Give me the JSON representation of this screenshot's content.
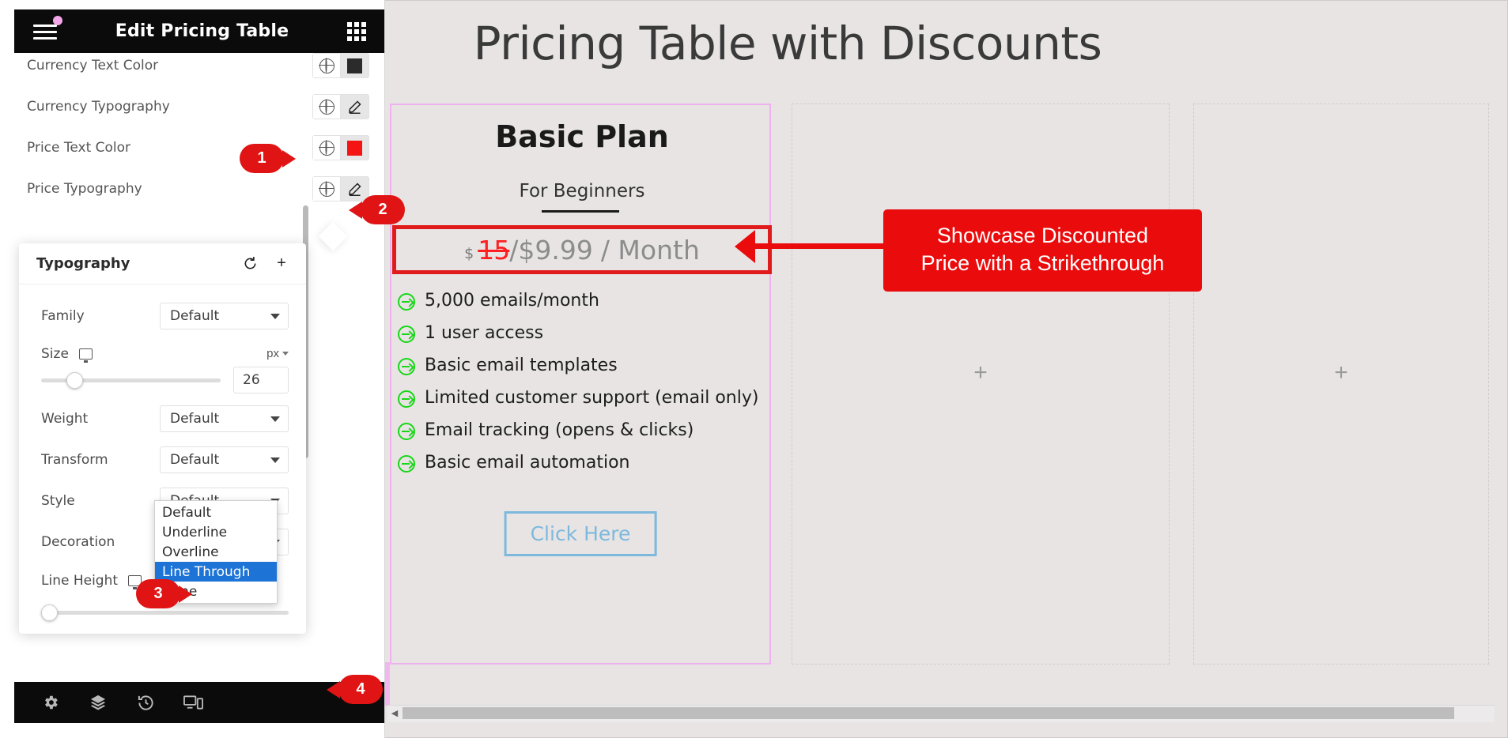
{
  "editor": {
    "header": {
      "title": "Edit Pricing Table",
      "menu_icon": "hamburger-icon",
      "apps_icon": "grid-apps-icon",
      "notification_dot": "#f3a6e8"
    },
    "settings": [
      {
        "label": "Currency Text Color",
        "globe_icon": "globe-icon",
        "second_icon": "color-swatch",
        "swatch_color": "#2b2b2b"
      },
      {
        "label": "Currency Typography",
        "globe_icon": "globe-icon",
        "second_icon": "pencil-edit-icon"
      },
      {
        "label": "Price Text Color",
        "globe_icon": "globe-icon",
        "second_icon": "color-swatch",
        "swatch_color": "#f51414"
      },
      {
        "label": "Price Typography",
        "globe_icon": "globe-icon",
        "second_icon": "pencil-edit-icon"
      }
    ],
    "typography_popover": {
      "title": "Typography",
      "reset_icon": "reset-arrow-icon",
      "add_icon": "plus-icon",
      "fields": {
        "family_label": "Family",
        "family_value": "Default",
        "size_label": "Size",
        "size_unit": "px",
        "size_value": "26",
        "weight_label": "Weight",
        "weight_value": "Default",
        "transform_label": "Transform",
        "transform_value": "Default",
        "style_label": "Style",
        "style_value": "Default",
        "decoration_label": "Decoration",
        "decoration_value": "Line Through",
        "line_height_label": "Line Height"
      },
      "decoration_options": [
        {
          "label": "Default",
          "selected": false
        },
        {
          "label": "Underline",
          "selected": false
        },
        {
          "label": "Overline",
          "selected": false
        },
        {
          "label": "Line Through",
          "selected": true
        },
        {
          "label": "None",
          "selected": false
        }
      ]
    },
    "bottom_toolbar": [
      {
        "icon": "settings-gear-icon",
        "name": "settings"
      },
      {
        "icon": "layers-navigator-icon",
        "name": "navigator"
      },
      {
        "icon": "history-clock-icon",
        "name": "history"
      },
      {
        "icon": "responsive-devices-icon",
        "name": "responsive-mode"
      }
    ],
    "collapse_icon": "chevron-left-icon"
  },
  "preview": {
    "page_title": "Pricing Table with Discounts",
    "card": {
      "plan_name": "Basic Plan",
      "subtitle": "For Beginners",
      "price": {
        "currency": "$",
        "old_price": "15",
        "separator": "/",
        "new_price": "$9.99",
        "period": "/ Month"
      },
      "features": [
        "5,000 emails/month",
        "1 user access",
        "Basic email templates",
        "Limited customer support (email only)",
        "Email tracking (opens & clicks)",
        "Basic email automation"
      ],
      "cta_label": "Click Here"
    },
    "empty_columns": [
      {
        "add_icon": "plus-icon"
      },
      {
        "add_icon": "plus-icon"
      }
    ]
  },
  "annotations": {
    "callout_text_line1": "Showcase Discounted",
    "callout_text_line2": "Price with a Strikethrough",
    "callout_color": "#ea0c0c",
    "steps": [
      {
        "number": "1"
      },
      {
        "number": "2"
      },
      {
        "number": "3"
      },
      {
        "number": "4"
      }
    ]
  }
}
